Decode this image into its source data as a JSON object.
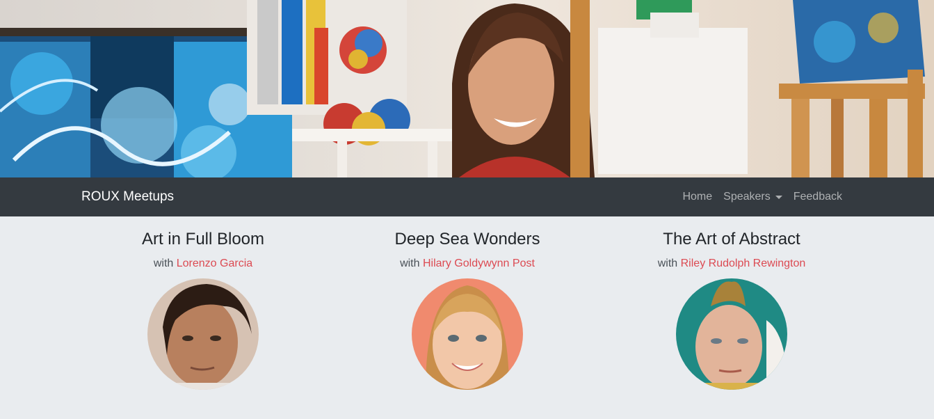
{
  "nav": {
    "brand": "ROUX Meetups",
    "links": [
      {
        "label": "Home"
      },
      {
        "label": "Speakers",
        "dropdown": true
      },
      {
        "label": "Feedback"
      }
    ]
  },
  "meetups": [
    {
      "title": "Art in Full Bloom",
      "with_prefix": "with",
      "speaker": "Lorenzo Garcia",
      "avatar_bg": "#c9b4a4"
    },
    {
      "title": "Deep Sea Wonders",
      "with_prefix": "with",
      "speaker": "Hilary Goldywynn Post",
      "avatar_bg": "#f08a6e"
    },
    {
      "title": "The Art of Abstract",
      "with_prefix": "with",
      "speaker": "Riley Rudolph Rewington",
      "avatar_bg": "#1f8a84"
    }
  ],
  "colors": {
    "navbar_bg": "#343a40",
    "page_bg": "#e9ecef",
    "accent_link": "#dc4a52"
  }
}
